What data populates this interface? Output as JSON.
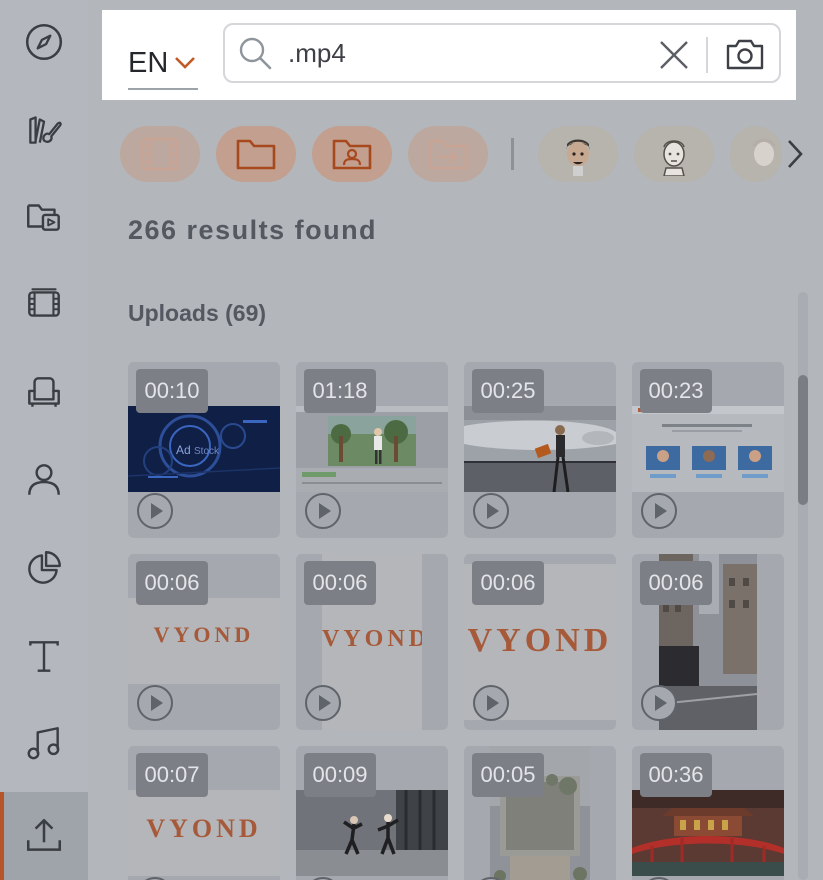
{
  "sidebar": {
    "items": [
      {
        "name": "explore",
        "icon": "compass-icon"
      },
      {
        "name": "templates",
        "icon": "brush-palette-icon"
      },
      {
        "name": "scenes",
        "icon": "folder-video-icon"
      },
      {
        "name": "video",
        "icon": "film-icon"
      },
      {
        "name": "props",
        "icon": "armchair-icon"
      },
      {
        "name": "characters",
        "icon": "person-icon"
      },
      {
        "name": "charts",
        "icon": "pie-chart-icon"
      },
      {
        "name": "text",
        "icon": "text-icon"
      },
      {
        "name": "audio",
        "icon": "music-note-icon"
      },
      {
        "name": "upload",
        "icon": "upload-icon",
        "active": true
      }
    ]
  },
  "search": {
    "language": "EN",
    "query": ".mp4",
    "clear_icon": "close-icon",
    "camera_icon": "camera-icon"
  },
  "filters": [
    {
      "name": "video",
      "icon": "film-icon",
      "state": "faint"
    },
    {
      "name": "folder",
      "icon": "folder-icon",
      "state": "active"
    },
    {
      "name": "user-folder",
      "icon": "user-folder-icon",
      "state": "active"
    },
    {
      "name": "move-to-folder",
      "icon": "folder-arrow-icon",
      "state": "faint"
    },
    {
      "name": "character-1",
      "icon": "character-avatar",
      "state": "avatar"
    },
    {
      "name": "character-2",
      "icon": "character-avatar",
      "state": "avatar"
    },
    {
      "name": "character-3",
      "icon": "character-avatar",
      "state": "avatar"
    }
  ],
  "results": {
    "count_text": "266 results found"
  },
  "uploads": {
    "title": "Uploads (69)",
    "items": [
      {
        "duration": "00:10",
        "type": "holo"
      },
      {
        "duration": "01:18",
        "type": "forest"
      },
      {
        "duration": "00:25",
        "type": "airport"
      },
      {
        "duration": "00:23",
        "type": "website"
      },
      {
        "duration": "00:06",
        "type": "vyond-small"
      },
      {
        "duration": "00:06",
        "type": "vyond-vertical"
      },
      {
        "duration": "00:06",
        "type": "vyond-large"
      },
      {
        "duration": "00:06",
        "type": "street"
      },
      {
        "duration": "00:07",
        "type": "vyond-small"
      },
      {
        "duration": "00:09",
        "type": "dance"
      },
      {
        "duration": "00:05",
        "type": "garden"
      },
      {
        "duration": "00:36",
        "type": "bridge"
      }
    ],
    "vyond_text": "VYOND"
  },
  "colors": {
    "accent": "#b4562a",
    "overlay": "#b3b6bb"
  }
}
